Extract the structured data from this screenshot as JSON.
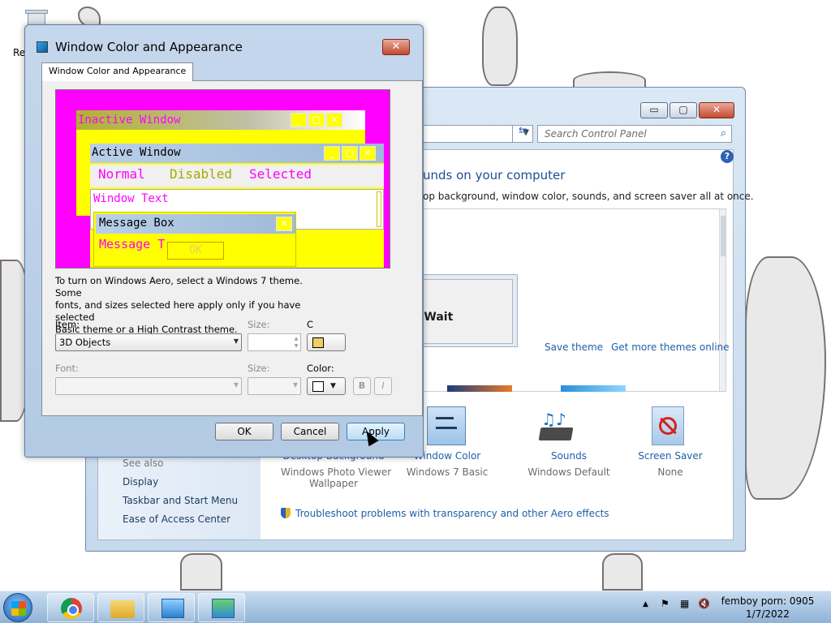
{
  "desktop": {
    "recycle_bin_label": "Re"
  },
  "control_panel": {
    "search_placeholder": "Search Control Panel",
    "heading": "unds on your computer",
    "description": "op background, window color, sounds, and screen saver all at once.",
    "save_theme": "Save theme",
    "more_themes": "Get more themes online",
    "see_also": "See also",
    "sidebar_links": [
      "Display",
      "Taskbar and Start Menu",
      "Ease of Access Center"
    ],
    "bottom_items": [
      {
        "label": "Desktop Background",
        "sub": "Windows Photo Viewer Wallpaper",
        "sub1": "Windows Photo Viewer",
        "sub2": "Wallpaper"
      },
      {
        "label": "Window Color",
        "sub": "Windows 7 Basic"
      },
      {
        "label": "Sounds",
        "sub": "Windows Default"
      },
      {
        "label": "Screen Saver",
        "sub": "None"
      }
    ],
    "troubleshoot": "Troubleshoot problems with transparency and other Aero effects",
    "min_glyph": "▭",
    "max_glyph": "▢",
    "close_glyph": "✕"
  },
  "please_wait": {
    "text": "Please Wait"
  },
  "dialog": {
    "title": "Window Color and Appearance",
    "tab": "Window Color and Appearance",
    "close_glyph": "✕",
    "preview": {
      "inactive_title": "Inactive Window",
      "active_title": "Active Window",
      "menu_normal": "Normal",
      "menu_disabled": "Disabled",
      "menu_selected": "Selected",
      "window_text": "Window Text",
      "msg_title": "Message Box",
      "msg_text": "Message T",
      "ok": "OK"
    },
    "explain_1": "To turn on Windows Aero, select a Windows 7 theme.  Some",
    "explain_2": "fonts, and sizes selected here apply only if you have selected",
    "explain_3": "Basic theme or a High Contrast theme.",
    "item_label": "Item:",
    "item_value": "3D Objects",
    "size_label": "Size:",
    "color1_label": "C",
    "font_label": "Font:",
    "font_value": "",
    "size2_label": "Size:",
    "color_label": "Color:",
    "bold": "B",
    "italic": "I",
    "ok": "OK",
    "cancel": "Cancel",
    "apply": "Apply"
  },
  "taskbar": {
    "clock_line1": "femboy porn: 0905",
    "clock_line2": "1/7/2022"
  },
  "colors": {
    "preview_bg": "#ff00ff",
    "preview_yellow": "#ffff00",
    "link_blue": "#1e5fa8"
  }
}
